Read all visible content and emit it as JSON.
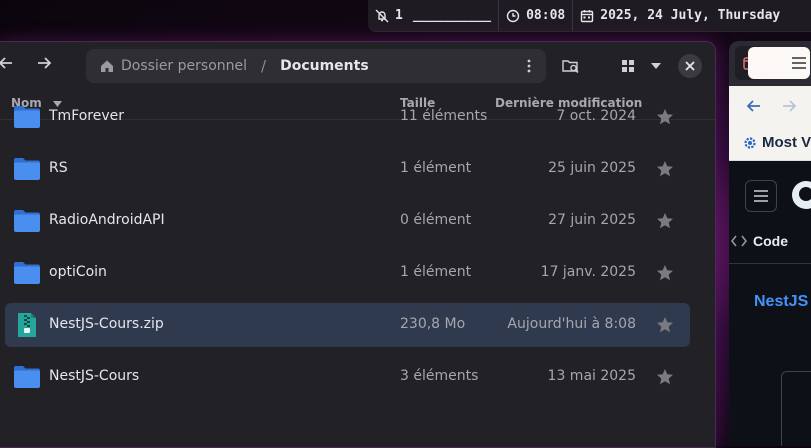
{
  "topbar": {
    "notifications_count": "1",
    "workspace_bar": "__________",
    "time": "08:08",
    "date": "2025, 24 July, Thursday"
  },
  "file_manager": {
    "breadcrumb": {
      "home": "Dossier personnel",
      "separator": "/",
      "current": "Documents"
    },
    "columns": {
      "name": "Nom",
      "size": "Taille",
      "modified": "Dernière modification"
    },
    "rows": [
      {
        "name": "TmForever",
        "size": "11 éléments",
        "modified": "7 oct. 2024",
        "type": "folder",
        "selected": false
      },
      {
        "name": "RS",
        "size": "1 élément",
        "modified": "25 juin 2025",
        "type": "folder",
        "selected": false
      },
      {
        "name": "RadioAndroidAPI",
        "size": "0 élément",
        "modified": "27 juin 2025",
        "type": "folder",
        "selected": false
      },
      {
        "name": "optiCoin",
        "size": "1 élément",
        "modified": "17 janv. 2025",
        "type": "folder",
        "selected": false
      },
      {
        "name": "NestJS-Cours.zip",
        "size": "230,8 Mo",
        "modified": "Aujourd'hui à 8:08",
        "type": "archive",
        "selected": true
      },
      {
        "name": "NestJS-Cours",
        "size": "3 éléments",
        "modified": "13 mai 2025",
        "type": "folder",
        "selected": false
      }
    ],
    "colors": {
      "folder": "#4a8ff0",
      "selection": "#2f3a4e",
      "archive": "#26a69a"
    }
  },
  "browser": {
    "bookmark_label": "Most Vi",
    "code_tab": "Code",
    "repo_title": "NestJS ."
  }
}
